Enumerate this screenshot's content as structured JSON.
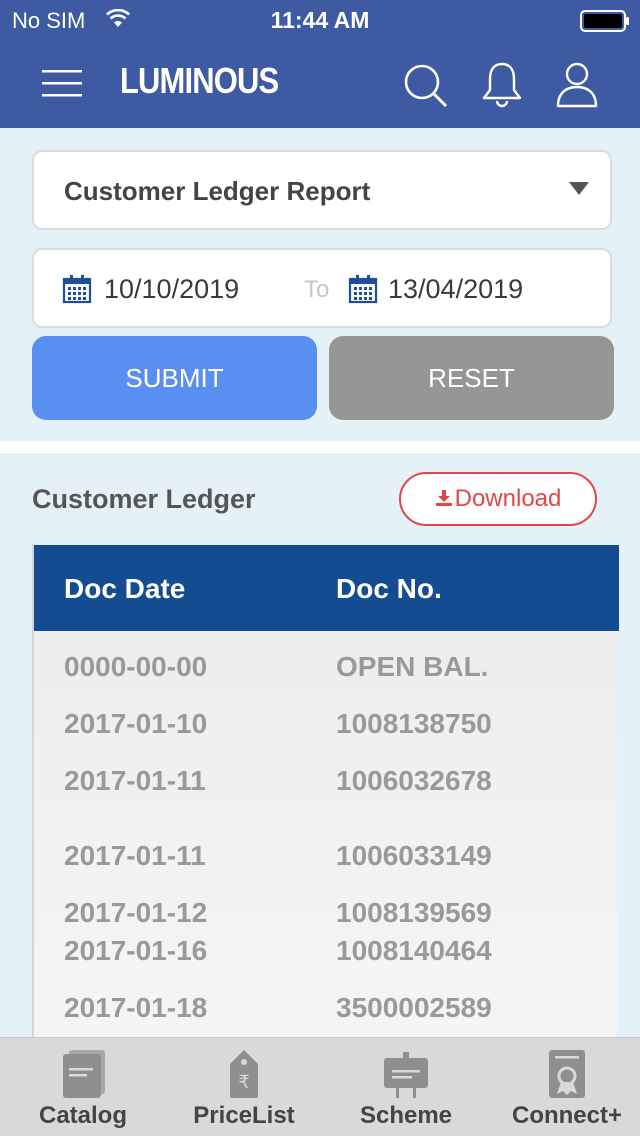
{
  "status_bar": {
    "carrier": "No SIM",
    "time": "11:44 AM"
  },
  "header": {
    "logo": "LUMINOUS"
  },
  "filters": {
    "report_type": "Customer Ledger Report",
    "from_date": "10/10/2019",
    "to_label": "To",
    "to_date": "13/04/2019",
    "submit_label": "SUBMIT",
    "reset_label": "RESET"
  },
  "ledger": {
    "title": "Customer Ledger",
    "download_label": "Download",
    "columns": [
      "Doc Date",
      "Doc No."
    ],
    "rows": [
      [
        "0000-00-00",
        "OPEN BAL."
      ],
      [
        "2017-01-10",
        "1008138750"
      ],
      [
        "2017-01-11",
        "1006032678"
      ],
      [
        "2017-01-11",
        "1006033149"
      ],
      [
        "2017-01-12",
        "1008139569"
      ],
      [
        "2017-01-16",
        "1008140464"
      ],
      [
        "2017-01-18",
        "3500002589"
      ]
    ]
  },
  "tabs": [
    {
      "label": "Catalog",
      "icon": "catalog-icon"
    },
    {
      "label": "PriceList",
      "icon": "pricelist-icon"
    },
    {
      "label": "Scheme",
      "icon": "scheme-icon"
    },
    {
      "label": "Connect+",
      "icon": "connect-icon"
    }
  ],
  "colors": {
    "nav": "#3d5aa3",
    "table_header": "#144c91",
    "submit": "#5a8ff2",
    "reset": "#969696",
    "download": "#e04848"
  }
}
